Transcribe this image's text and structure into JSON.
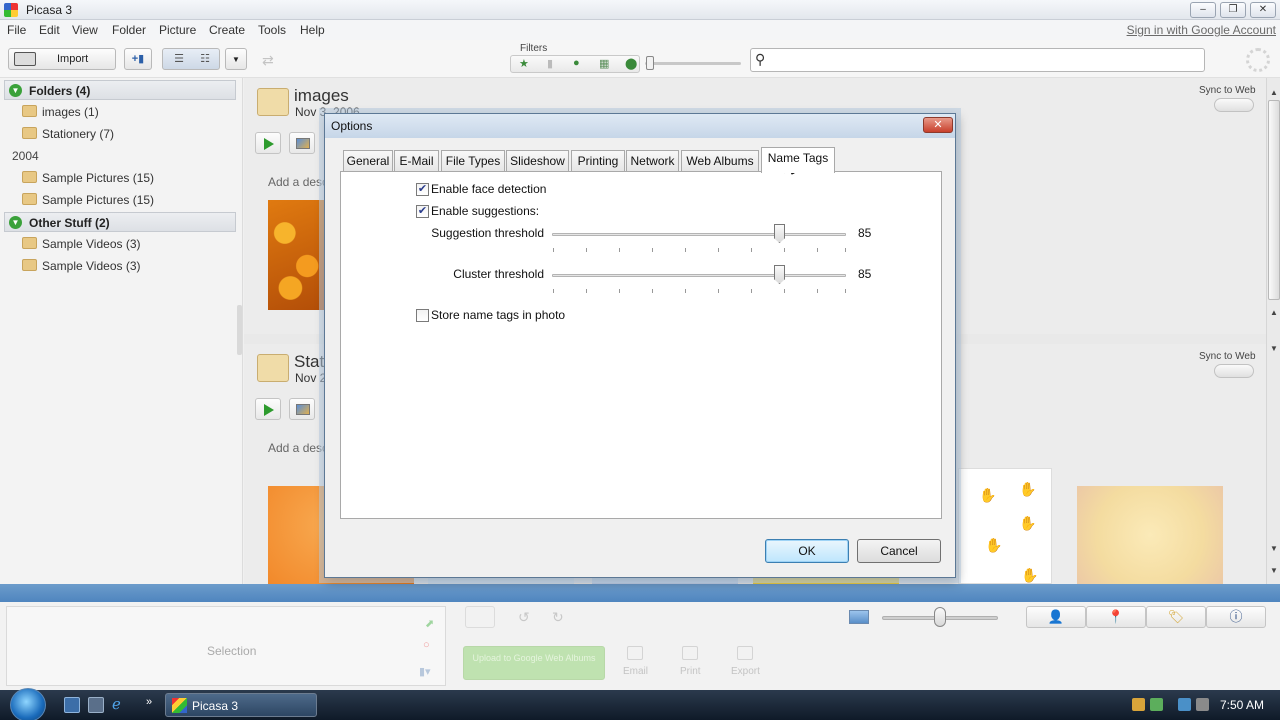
{
  "window": {
    "title": "Picasa 3"
  },
  "menu": {
    "items": [
      "File",
      "Edit",
      "View",
      "Folder",
      "Picture",
      "Create",
      "Tools",
      "Help"
    ],
    "signin": "Sign in with Google Account"
  },
  "toolbar": {
    "import_label": "Import",
    "filters_label": "Filters"
  },
  "left_panel": {
    "groups": [
      {
        "label": "Folders (4)"
      },
      {
        "label": "Other Stuff (2)"
      }
    ],
    "folders": [
      {
        "label": "images (1)"
      },
      {
        "label": "Stationery (7)"
      },
      {
        "label": "Sample Pictures (15)"
      },
      {
        "label": "Sample Pictures (15)"
      },
      {
        "label": "Sample Videos (3)"
      },
      {
        "label": "Sample Videos (3)"
      }
    ],
    "year": "2004"
  },
  "library": {
    "sections": [
      {
        "title": "images",
        "date": "Nov 3, 2006",
        "description_placeholder": "Add a desc",
        "sync_label": "Sync to Web"
      },
      {
        "title": "Stat",
        "date": "Nov 2",
        "description_placeholder": "Add a desc",
        "sync_label": "Sync to Web"
      }
    ]
  },
  "tray": {
    "selection_label": "Selection",
    "upload_label": "Upload to Google Web Albums",
    "email_label": "Email",
    "print_label": "Print",
    "export_label": "Export"
  },
  "taskbar": {
    "task_label": "Picasa 3",
    "clock": "7:50 AM"
  },
  "dialog": {
    "title": "Options",
    "close_label": "✕",
    "tabs": [
      "General",
      "E-Mail",
      "File Types",
      "Slideshow",
      "Printing",
      "Network",
      "Web Albums",
      "Name Tags"
    ],
    "active_tab": "Name Tags",
    "name_tags": {
      "enable_face_detection": {
        "label": "Enable face detection",
        "checked": true
      },
      "enable_suggestions": {
        "label": "Enable suggestions:",
        "checked": true
      },
      "suggestion_threshold": {
        "label": "Suggestion threshold",
        "value": "85"
      },
      "cluster_threshold": {
        "label": "Cluster threshold",
        "value": "85"
      },
      "store_name_tags": {
        "label": "Store name tags in photo",
        "checked": false
      }
    },
    "ok_label": "OK",
    "cancel_label": "Cancel"
  }
}
